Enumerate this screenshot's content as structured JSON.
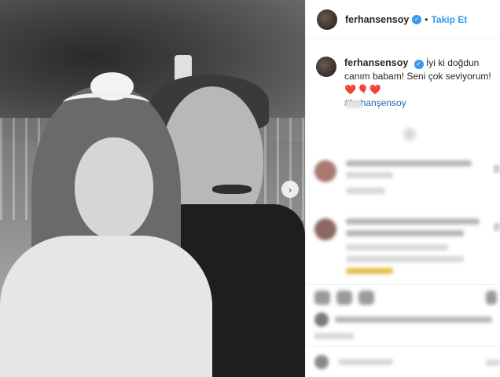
{
  "post": {
    "header": {
      "username": "ferhansensoy",
      "verified_badge": "✓",
      "separator": "•",
      "follow_label": "Takip Et"
    },
    "caption": {
      "username": "ferhansensoy",
      "text": "İyi ki doğdun canım babam! Seni çok seviyorum!",
      "emoji": "❤️🎈❤️",
      "hashtag": "#ferhanşensoy"
    },
    "carousel_next_icon": "›",
    "icons": {
      "avatar": "avatar",
      "verified": "verified-badge-icon",
      "carousel": "chevron-right-icon",
      "like": "heart-icon",
      "comment": "comment-icon",
      "share": "share-icon",
      "save": "bookmark-icon"
    },
    "colors": {
      "link_blue": "#3897f0",
      "hashtag_blue": "#1f5fa8",
      "heart_red": "#d8203a"
    }
  }
}
